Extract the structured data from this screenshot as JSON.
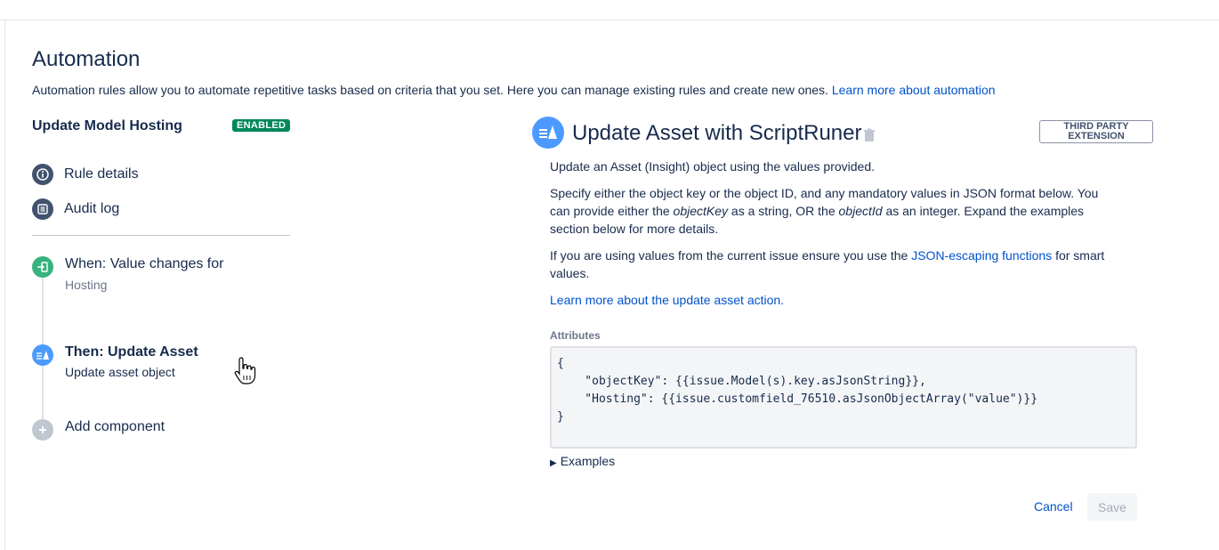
{
  "page": {
    "title": "Automation",
    "description": "Automation rules allow you to automate repetitive tasks based on criteria that you set. Here you can manage existing rules and create new ones.",
    "learn_more": "Learn more about automation"
  },
  "rule": {
    "name": "Update Model Hosting",
    "status": "ENABLED",
    "nav": [
      {
        "label": "Rule details",
        "icon": "info-icon"
      },
      {
        "label": "Audit log",
        "icon": "list-icon"
      }
    ],
    "steps": [
      {
        "title": "When: Value changes for",
        "subtitle": "Hosting",
        "icon": "trigger-icon",
        "color": "#36b37e"
      },
      {
        "title": "Then: Update Asset",
        "subtitle": "Update asset object",
        "icon": "asset-icon",
        "color": "#4c9aff"
      },
      {
        "title": "Add component",
        "icon": "plus-icon",
        "color": "#c1c7d0"
      }
    ]
  },
  "panel": {
    "title": "Update Asset with ScriptRuner",
    "badge_line1": "THIRD PARTY",
    "badge_line2": "EXTENSION",
    "p1": "Update an Asset (Insight) object using the values provided.",
    "p2_a": "Specify either the object key or the object ID, and any mandatory values in JSON format below. You can provide either the ",
    "p2_key": "objectKey",
    "p2_b": " as a string, OR the ",
    "p2_id": "objectId",
    "p2_c": " as an integer. Expand the examples section below for more details.",
    "p3_a": "If you are using values from the current issue ensure you use the ",
    "p3_link": "JSON-escaping functions",
    "p3_b": " for smart values.",
    "learn_link": "Learn more about the update asset action.",
    "attributes_label": "Attributes",
    "code": "{\n    \"objectKey\": {{issue.Model(s).key.asJsonString}},\n    \"Hosting\": {{issue.customfield_76510.asJsonObjectArray(\"value\")}}\n}",
    "examples": "Examples",
    "cancel": "Cancel",
    "save": "Save"
  }
}
